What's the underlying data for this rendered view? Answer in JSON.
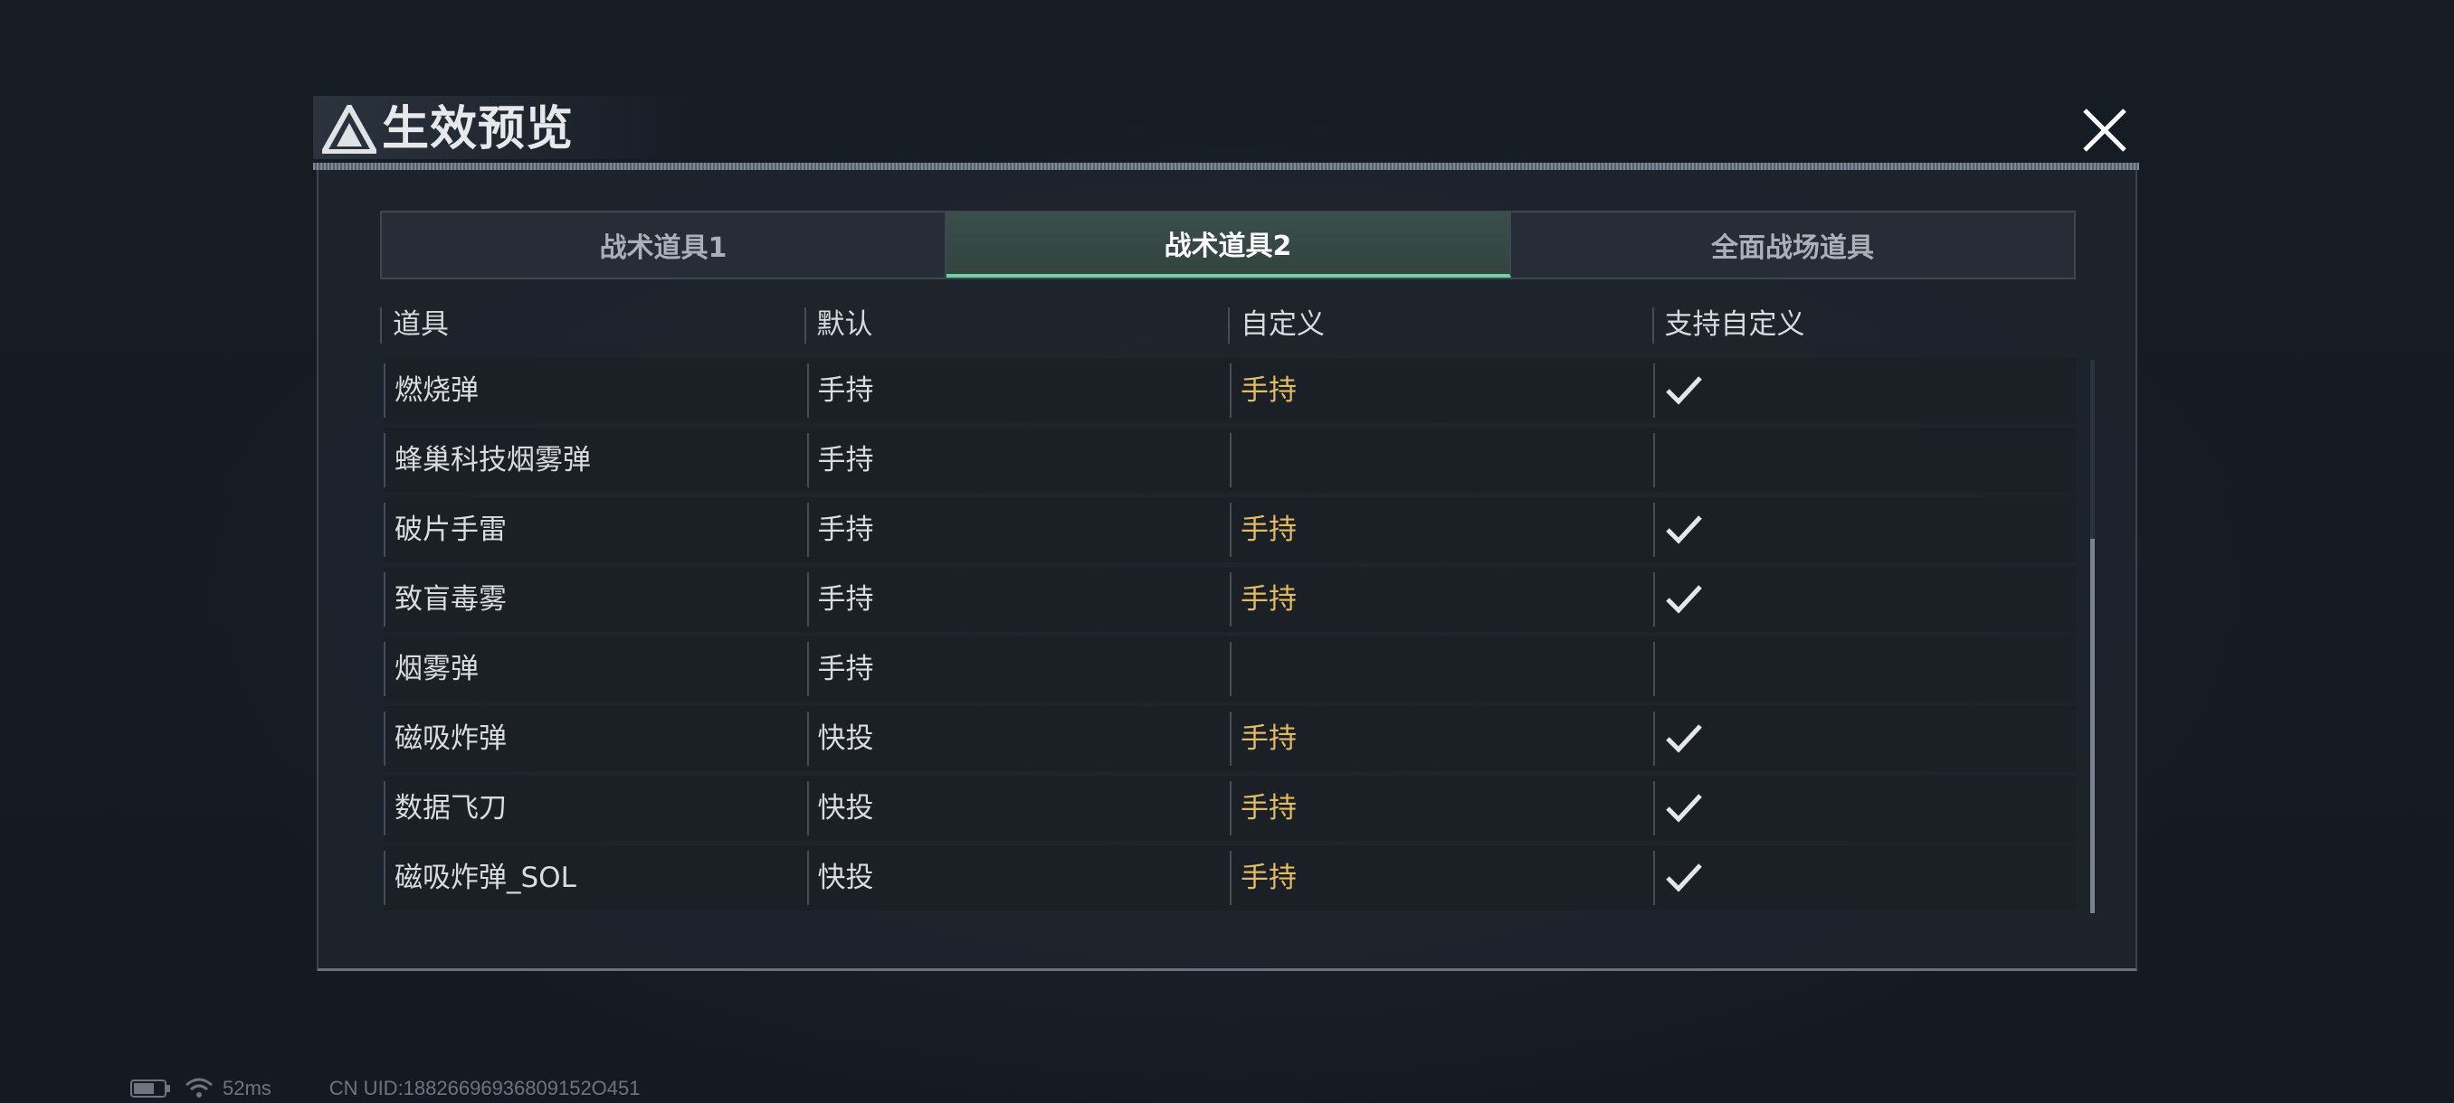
{
  "dialog": {
    "title": "生效预览"
  },
  "tabs": [
    {
      "label": "战术道具1",
      "active": false
    },
    {
      "label": "战术道具2",
      "active": true
    },
    {
      "label": "全面战场道具",
      "active": false
    }
  ],
  "table": {
    "columns": [
      "道具",
      "默认",
      "自定义",
      "支持自定义"
    ],
    "rows": [
      {
        "item": "燃烧弹",
        "default": "手持",
        "custom": "手持",
        "supported": true
      },
      {
        "item": "蜂巢科技烟雾弹",
        "default": "手持",
        "custom": "",
        "supported": false
      },
      {
        "item": "破片手雷",
        "default": "手持",
        "custom": "手持",
        "supported": true
      },
      {
        "item": "致盲毒雾",
        "default": "手持",
        "custom": "手持",
        "supported": true
      },
      {
        "item": "烟雾弹",
        "default": "手持",
        "custom": "",
        "supported": false
      },
      {
        "item": "磁吸炸弹",
        "default": "快投",
        "custom": "手持",
        "supported": true
      },
      {
        "item": "数据飞刀",
        "default": "快投",
        "custom": "手持",
        "supported": true
      },
      {
        "item": "磁吸炸弹_SOL",
        "default": "快投",
        "custom": "手持",
        "supported": true
      }
    ]
  },
  "status_bar": {
    "latency": "52ms",
    "uid": "CN UID:18826696936809152O451"
  },
  "colors": {
    "accent_tab": "#6fd3a0",
    "custom_value": "#e3bd5d",
    "background": "#151b23"
  },
  "icons": {
    "logo": "triangle-logo-icon",
    "close": "close-icon",
    "check": "check-icon",
    "battery": "battery-icon",
    "wifi": "wifi-icon"
  }
}
